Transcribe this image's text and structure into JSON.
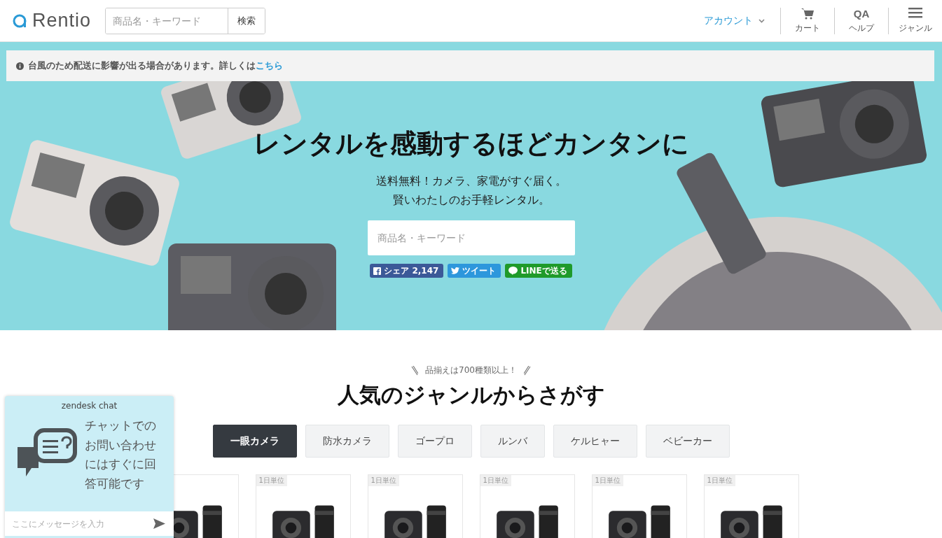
{
  "header": {
    "logo": "Rentio",
    "search": {
      "placeholder": "商品名・キーワード",
      "button": "検索"
    },
    "account": "アカウント",
    "nav": [
      {
        "kind": "cart",
        "label": "カート"
      },
      {
        "kind": "help",
        "label": "ヘルプ",
        "glyph": "QA"
      },
      {
        "kind": "menu",
        "label": "ジャンル"
      }
    ]
  },
  "notice": {
    "text": "台風のため配送に影響が出る場合があります。詳しくは",
    "link": "こちら"
  },
  "hero": {
    "title": "レンタルを感動するほどカンタンに",
    "subtitle": [
      "送料無料！カメラ、家電がすぐ届く。",
      "賢いわたしのお手軽レンタル。"
    ],
    "search_placeholder": "商品名・キーワード",
    "share": [
      {
        "kind": "facebook",
        "label": "シェア 2,147"
      },
      {
        "kind": "twitter",
        "label": "ツイート"
      },
      {
        "kind": "line",
        "label": "LINEで送る"
      }
    ]
  },
  "genres": {
    "tagline": "品揃えは700種類以上！",
    "heading": "人気のジャンルからさがす",
    "tabs": [
      {
        "label": "一眼カメラ",
        "selected": true
      },
      {
        "label": "防水カメラ",
        "selected": false
      },
      {
        "label": "ゴープロ",
        "selected": false
      },
      {
        "label": "ルンバ",
        "selected": false
      },
      {
        "label": "ケルヒャー",
        "selected": false
      },
      {
        "label": "ベビーカー",
        "selected": false
      }
    ],
    "products": [
      {
        "kind": "picture"
      },
      {
        "kind": "picture",
        "badge": "1日単位"
      },
      {
        "kind": "picture",
        "badge": "1日単位"
      },
      {
        "kind": "picture",
        "badge": "1日単位"
      },
      {
        "kind": "picture",
        "badge": "1日単位"
      },
      {
        "kind": "picture",
        "badge": "1日単位"
      }
    ]
  },
  "chat": {
    "brand": "zendesk chat",
    "message": "チャットでのお問い合わせにはすぐに回答可能です",
    "placeholder": "ここにメッセージを入力"
  }
}
